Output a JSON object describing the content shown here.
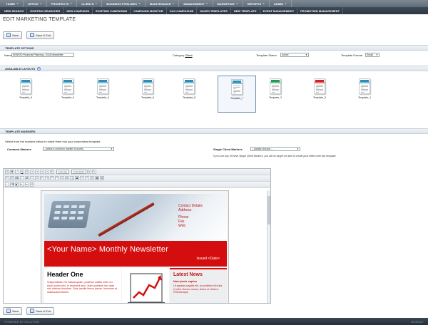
{
  "topnav": [
    "HOME",
    "OFFICE",
    "PROSPECTS",
    "CLIENTS",
    "BUSINESS PIPELINES",
    "MAINTENANCE",
    "MANAGEMENT",
    "MARKETING",
    "REPORTS",
    "ADMIN"
  ],
  "subnav": [
    "NEW SEARCH",
    "EXISTING SEARCHES",
    "NEW CAMPAIGN",
    "EXISTING CAMPAIGNS",
    "CAMPAIGN MONITOR",
    "OLD CAMPAIGNS",
    "SAVED TEMPLATES",
    "NEW TEMPLATE",
    "EVENT MANAGEMENT",
    "PROMOTION MANAGEMENT"
  ],
  "page_title": "EDIT MARKETING TEMPLATE",
  "buttons": {
    "save": "Save",
    "save_exit": "Save & Exit"
  },
  "template_options": {
    "heading": "TEMPLATE OPTIONS",
    "name_label": "Name",
    "name_value": "SENRIO Financial Planning - EOA Newsletter",
    "category_label": "Category",
    "category_value": "Client",
    "status_label": "Template Status",
    "status_value": "Active",
    "format_label": "Template Format",
    "format_value": "Email"
  },
  "layouts": {
    "heading": "AVAILABLE LAYOUTS",
    "help_icon": "question-icon",
    "items": [
      {
        "name": "Template_5",
        "accent": "#2a8fb8",
        "selected": false
      },
      {
        "name": "Template_9",
        "accent": "#2a8fb8",
        "selected": false
      },
      {
        "name": "Template_4",
        "accent": "#2a8fb8",
        "selected": false
      },
      {
        "name": "Template_6",
        "accent": "#2a8fb8",
        "selected": false
      },
      {
        "name": "Template_8",
        "accent": "#2a8fb8",
        "selected": false
      },
      {
        "name": "Template_7",
        "accent": "#2a8fb8",
        "selected": true
      },
      {
        "name": "Template_2",
        "accent": "#1e9a55",
        "selected": false
      },
      {
        "name": "Template_3",
        "accent": "#d42020",
        "selected": false
      },
      {
        "name": "Template_1",
        "accent": "#2a8fb8",
        "selected": false
      }
    ]
  },
  "markers": {
    "heading": "TEMPLATE MARKERS",
    "intro": "Select from the markers below to insert them into your customised template",
    "common_label": "Common Markers",
    "common_value": "--select a common marker to insert--",
    "client_label": "Single Client Markers",
    "client_value": "-- please choose --",
    "note": "If you use any of these Single Client Markers, you will no longer be able to create post letters with this template."
  },
  "editor": {
    "font_size": "Font size",
    "font_family": "Font family",
    "contact": [
      "Contact Details",
      "Address",
      "",
      "Phone",
      "Fax",
      "Web"
    ],
    "newsletter_title": "<Your Name> Monthly Newsletter",
    "issued": "Issued <Date>",
    "header_one": "Header One",
    "body_text": "Suspendisse vel massa quam, pulvinar mattis enim eu risus luctus nisl, in tincidunt arcu. Nam pulvinar leo vitae nisl ultrices tincidunt. Duis iaculis lorem ipsum. Interdum et malesuada fames.",
    "latest_news": "Latest News",
    "news_name": "Nam justo sapien",
    "news_text": "Ut egestas sagittis elit, ac porttitor elit nulla et nibh. Donec cursus, lectus et ultrices. Pellentesque"
  },
  "footer": {
    "left": "POWERED BY SOLUTION",
    "right": "SIGNOUT"
  }
}
